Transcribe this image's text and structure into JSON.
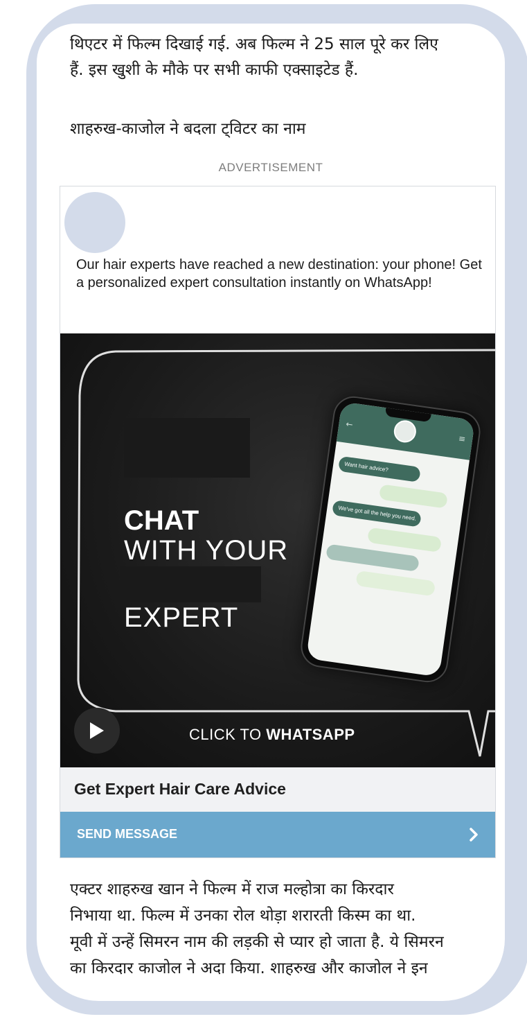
{
  "article": {
    "para1": "थिएटर में फिल्म दिखाई गई. अब फिल्म ने 25 साल पूरे कर लिए\nहैं. इस खुशी के मौके पर सभी काफी एक्साइटेड हैं.",
    "para2": "शाहरुख-काजोल ने बदला ट्विटर का नाम",
    "para3": "एक्टर शाहरुख खान ने फिल्म में राज मल्होत्रा का किरदार\nनिभाया था. फिल्म में उनका रोल थोड़ा शरारती किस्म का था.\nमूवी में उन्हें सिमरन नाम की लड़की से प्यार हो जाता है. ये सिमरन\nका किरदार काजोल ने अदा किया. शाहरुख और काजोल ने इन"
  },
  "ad": {
    "label": "ADVERTISEMENT",
    "body": "Our hair experts have reached a new destination: your phone! Get a personalized expert consultation instantly on WhatsApp!",
    "media": {
      "headline_bold": "CHAT",
      "headline_line2": "WITH YOUR",
      "headline_line3": "EXPERT",
      "cta_prefix": "CLICK TO ",
      "cta_bold": "WHATSAPP",
      "chat_bubbles": [
        "Want hair advice?",
        "We've got all the help you need."
      ]
    },
    "title": "Get Expert Hair Care Advice",
    "button_label": "SEND MESSAGE"
  },
  "colors": {
    "frame": "#d3dbea",
    "button": "#6ba8cd",
    "phone_header": "#3f6b5e"
  },
  "icons": [
    "play-icon",
    "chevron-right-icon",
    "back-arrow-icon",
    "menu-icon"
  ]
}
